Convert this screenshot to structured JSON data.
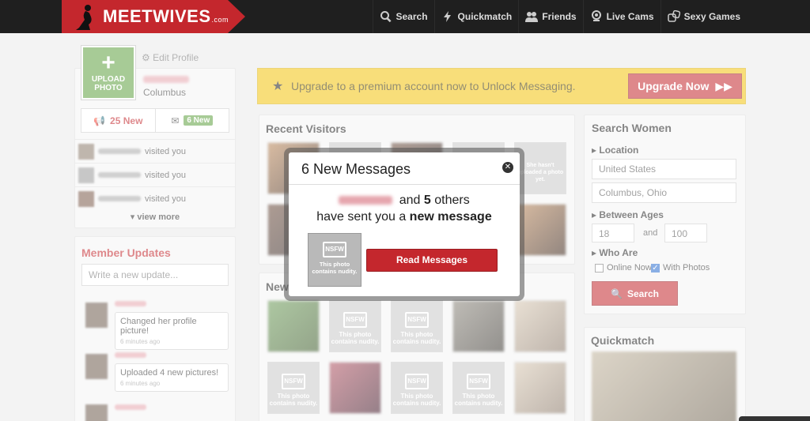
{
  "header": {
    "logo_text": "MEETWIVES",
    "logo_tld": ".com",
    "nav": [
      {
        "label": "Search",
        "icon": "search-icon"
      },
      {
        "label": "Quickmatch",
        "icon": "lightning-icon"
      },
      {
        "label": "Friends",
        "icon": "friends-icon"
      },
      {
        "label": "Live Cams",
        "icon": "webcam-icon"
      },
      {
        "label": "Sexy Games",
        "icon": "dice-icon"
      }
    ]
  },
  "profile": {
    "upload_label": "UPLOAD PHOTO",
    "edit_label": "Edit Profile",
    "city": "Columbus",
    "visits_tab": "25 New",
    "messages_badge": "6 New",
    "visits": [
      "visited you",
      "visited you",
      "visited you"
    ],
    "view_more": "view more"
  },
  "updates": {
    "title": "Member Updates",
    "placeholder": "Write a new update...",
    "items": [
      {
        "text": "Changed her profile picture!",
        "ago": "6 minutes ago"
      },
      {
        "text": "Uploaded 4 new pictures!",
        "ago": "6 minutes ago"
      }
    ]
  },
  "banner": {
    "text": "Upgrade to a premium account now to Unlock Messaging.",
    "button": "Upgrade Now"
  },
  "visitors": {
    "title": "Recent Visitors",
    "placeholder_text": "She hasn't uploaded a photo yet."
  },
  "new_members": {
    "title": "New",
    "nsfw_label": "NSFW",
    "nsfw_caption": "This photo contains nudity."
  },
  "search": {
    "title": "Search Women",
    "location_label": "Location",
    "country": "United States",
    "city": "Columbus, Ohio",
    "ages_label": "Between Ages",
    "age_from": "18",
    "age_and": "and",
    "age_to": "100",
    "who_label": "Who Are",
    "online_now": "Online Now",
    "with_photos": "With Photos",
    "button": "Search"
  },
  "quickmatch": {
    "title": "Quickmatch"
  },
  "modal": {
    "title": "6 New Messages",
    "and": "and",
    "others_count": "5",
    "others": "others",
    "line2_prefix": "have sent you a",
    "line2_bold": "new message",
    "nsfw_label": "NSFW",
    "nsfw_caption": "This photo contains nudity.",
    "button": "Read Messages"
  },
  "colors": {
    "brand_red": "#c4272d",
    "banner_yellow": "#f2c40e",
    "green": "#5fa140"
  }
}
